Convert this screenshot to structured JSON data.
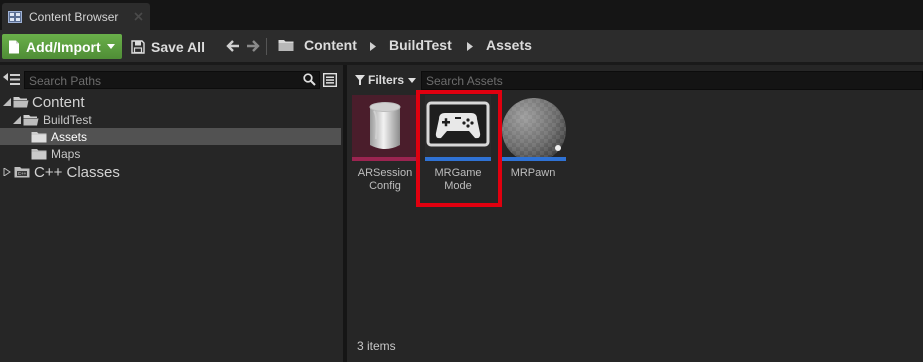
{
  "tab": {
    "title": "Content Browser"
  },
  "toolbar": {
    "add_import_label": "Add/Import",
    "save_all_label": "Save All",
    "breadcrumbs": [
      "Content",
      "BuildTest",
      "Assets"
    ]
  },
  "sources": {
    "search_placeholder": "Search Paths",
    "tree": {
      "content": "Content",
      "buildtest": "BuildTest",
      "assets": "Assets",
      "maps": "Maps",
      "cpp_classes": "C++ Classes"
    }
  },
  "assets": {
    "filters_label": "Filters",
    "search_placeholder": "Search Assets",
    "items": [
      {
        "name": "ARSession Config",
        "line1": "ARSession",
        "line2": "Config",
        "icon": "data-asset-icon"
      },
      {
        "name": "MRGame Mode",
        "line1": "MRGame",
        "line2": "Mode",
        "icon": "gamepad-icon"
      },
      {
        "name": "MRPawn",
        "line1": "MRPawn",
        "line2": "",
        "icon": "sphere-icon"
      }
    ],
    "count_label": "3 items"
  },
  "colors": {
    "add_button": "#5a9e3f",
    "selection_highlight": "#e0000f",
    "blueprint_stripe": "#2f72d4",
    "data_asset_stripe": "#9b2450"
  }
}
